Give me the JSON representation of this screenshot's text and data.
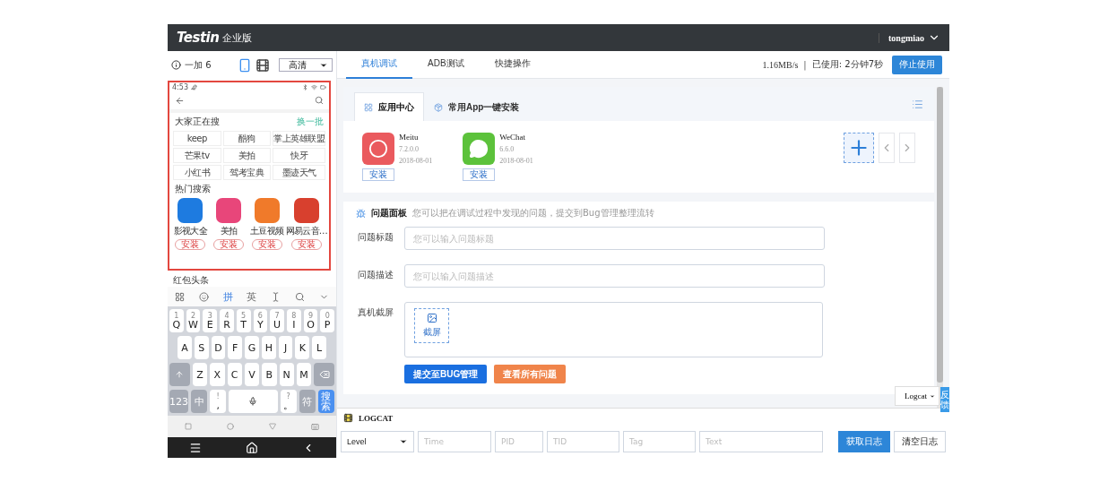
{
  "header": {
    "logo": "Testin",
    "edition": "企业版",
    "user": "tongmiao"
  },
  "device": {
    "name": "一加 6",
    "orientations": [
      {
        "kind": "portrait",
        "selected": true
      },
      {
        "kind": "landscape",
        "selected": false
      }
    ],
    "quality": "高清"
  },
  "phone": {
    "time": "4:53",
    "section_title": "大家正在搜",
    "refresh": "换一批",
    "terms": [
      "keep",
      "酷狗",
      "掌上英雄联盟",
      "芒果tv",
      "美拍",
      "快牙",
      "小红书",
      "驾考宝典",
      "墨迹天气"
    ],
    "apps_title": "热门搜索",
    "apps": [
      {
        "name": "影视大全",
        "install": "安装",
        "color": "#1e7be0"
      },
      {
        "name": "美拍",
        "install": "安装",
        "color": "#e8467a"
      },
      {
        "name": "土豆视频",
        "install": "安装",
        "color": "#f07a2a"
      },
      {
        "name": "网易云音…",
        "install": "安装",
        "color": "#d8402e"
      }
    ],
    "below": "红包头条",
    "toolbar": [
      {
        "kind": "grid"
      },
      {
        "kind": "emoji"
      },
      {
        "kind": "text",
        "label": "拼",
        "selected": true
      },
      {
        "kind": "text",
        "label": "英",
        "selected": false
      },
      {
        "kind": "cursor"
      },
      {
        "kind": "search"
      },
      {
        "kind": "collapse"
      }
    ],
    "key_rows": [
      {
        "keys": [
          {
            "kind": "letter",
            "label": "Q",
            "hint": "1"
          },
          {
            "kind": "letter",
            "label": "W",
            "hint": "2"
          },
          {
            "kind": "letter",
            "label": "E",
            "hint": "3"
          },
          {
            "kind": "letter",
            "label": "R",
            "hint": "4"
          },
          {
            "kind": "letter",
            "label": "T",
            "hint": "5"
          },
          {
            "kind": "letter",
            "label": "Y",
            "hint": "6"
          },
          {
            "kind": "letter",
            "label": "U",
            "hint": "7"
          },
          {
            "kind": "letter",
            "label": "I",
            "hint": "8"
          },
          {
            "kind": "letter",
            "label": "O",
            "hint": "9"
          },
          {
            "kind": "letter",
            "label": "P",
            "hint": "0"
          }
        ]
      },
      {
        "keys": [
          {
            "kind": "letter",
            "label": "A"
          },
          {
            "kind": "letter",
            "label": "S"
          },
          {
            "kind": "letter",
            "label": "D"
          },
          {
            "kind": "letter",
            "label": "F"
          },
          {
            "kind": "letter",
            "label": "G"
          },
          {
            "kind": "letter",
            "label": "H"
          },
          {
            "kind": "letter",
            "label": "J"
          },
          {
            "kind": "letter",
            "label": "K"
          },
          {
            "kind": "letter",
            "label": "L"
          }
        ]
      },
      {
        "keys": [
          {
            "kind": "shift"
          },
          {
            "kind": "letter",
            "label": "Z"
          },
          {
            "kind": "letter",
            "label": "X"
          },
          {
            "kind": "letter",
            "label": "C"
          },
          {
            "kind": "letter",
            "label": "V"
          },
          {
            "kind": "letter",
            "label": "B"
          },
          {
            "kind": "letter",
            "label": "N"
          },
          {
            "kind": "letter",
            "label": "M"
          },
          {
            "kind": "backspace"
          }
        ]
      }
    ],
    "bottom_keys": [
      {
        "kind": "func",
        "label": "123"
      },
      {
        "kind": "func",
        "label": "中"
      },
      {
        "kind": "letter",
        "label": ",",
        "hint": "!"
      },
      {
        "kind": "space"
      },
      {
        "kind": "letter",
        "label": "。",
        "hint": "?"
      },
      {
        "kind": "func",
        "label": "符"
      },
      {
        "kind": "action",
        "label": "搜索"
      }
    ]
  },
  "tabs": [
    {
      "label": "真机调试",
      "selected": true
    },
    {
      "label": "ADB测试",
      "selected": false
    },
    {
      "label": "快捷操作",
      "selected": false
    }
  ],
  "status": {
    "speed": "1.16MB/s",
    "separator": "|",
    "used": "已使用: 2分钟7秒",
    "stop": "停止使用"
  },
  "app_center": {
    "tabs": [
      {
        "label": "应用中心",
        "selected": true
      },
      {
        "label": "常用App一键安装",
        "selected": false
      }
    ],
    "apps": [
      {
        "kind": "meitu",
        "name": "Meitu",
        "version": "7.2.0.0",
        "date": "2018-08-01",
        "install": "安装"
      },
      {
        "kind": "wechat",
        "name": "WeChat",
        "version": "6.6.0",
        "date": "2018-08-01",
        "install": "安装"
      }
    ]
  },
  "issue_panel": {
    "title": "问题面板",
    "hint": "您可以把在调试过程中发现的问题，提交到Bug管理整理流转",
    "title_label": "问题标题",
    "title_placeholder": "您可以输入问题标题",
    "desc_label": "问题描述",
    "desc_placeholder": "您可以输入问题描述",
    "shot_label": "真机截屏",
    "shot_button": "截屏",
    "submit": "提交至BUG管理",
    "view_all": "查看所有问题"
  },
  "logcat_select": "Logcat",
  "feedback": "反馈",
  "logcat": {
    "title": "LOGCAT",
    "level": "Level",
    "filters": [
      {
        "placeholder": "Time"
      },
      {
        "placeholder": "PID"
      },
      {
        "placeholder": "TID"
      },
      {
        "placeholder": "Tag"
      },
      {
        "placeholder": "Text"
      }
    ],
    "fetch": "获取日志",
    "clear": "清空日志"
  }
}
